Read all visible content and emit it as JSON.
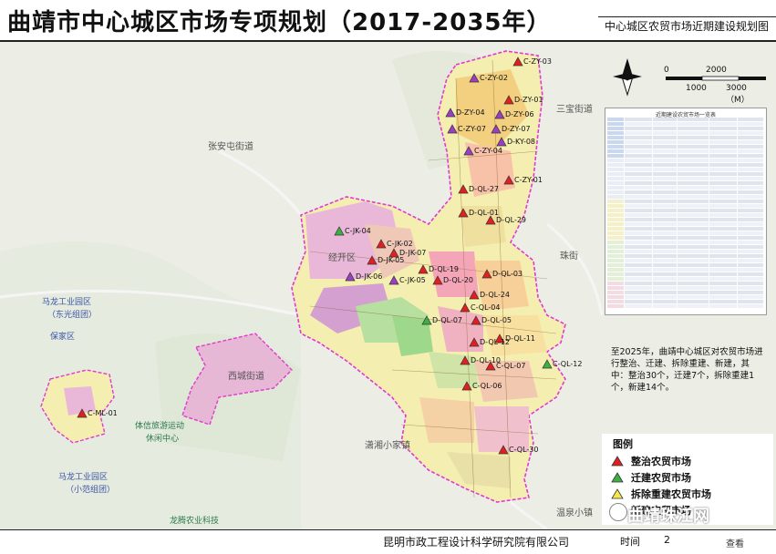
{
  "header": {
    "main_title": "曲靖市中心城区市场专项规划（2017-2035年）",
    "sub_title": "中心城区农贸市场近期建设规划图"
  },
  "scale": {
    "zero": "0",
    "mid_top": "2000",
    "mid_bottom": "1000",
    "end": "3000（M）"
  },
  "table": {
    "title": "近期建设农贸市场一览表"
  },
  "note": "至2025年，曲靖中心城区对农贸市场进行整治、迁建、拆除重建、新建，其中：整治30个，迁建7个，拆除重建1个，新建14个。",
  "legend": {
    "title": "图例",
    "items": [
      {
        "label": "整治农贸市场",
        "color": "#e02020"
      },
      {
        "label": "迁建农贸市场",
        "color": "#3cb043"
      },
      {
        "label": "拆除重建农贸市场",
        "color": "#f6e84a"
      },
      {
        "label": "新建农贸市场",
        "color": "#9a3fc0"
      }
    ]
  },
  "place_labels": [
    "张安屯街道",
    "经开区",
    "马龙工业园区",
    "（东光组团）",
    "保家区",
    "马龙工业园区",
    "（小范组团）",
    "体信旅游运动",
    "休闲中心",
    "龙腾农业科技",
    "潇湘小家镇",
    "三宝街道",
    "珠街",
    "西城街道",
    "温泉小镇"
  ],
  "markers": [
    {
      "label": "C-ZY-02",
      "type": "new"
    },
    {
      "label": "C-ZY-03",
      "type": "renovate"
    },
    {
      "label": "D-ZY-01",
      "type": "renovate"
    },
    {
      "label": "D-ZY-04",
      "type": "new"
    },
    {
      "label": "D-ZY-06",
      "type": "new"
    },
    {
      "label": "C-ZY-07",
      "type": "new"
    },
    {
      "label": "D-ZY-07",
      "type": "new"
    },
    {
      "label": "C-ZY-04",
      "type": "new"
    },
    {
      "label": "D-KY-08",
      "type": "new"
    },
    {
      "label": "C-ZY-01",
      "type": "renovate"
    },
    {
      "label": "D-QL-27",
      "type": "renovate"
    },
    {
      "label": "D-QL-01",
      "type": "renovate"
    },
    {
      "label": "D-QL-29",
      "type": "renovate"
    },
    {
      "label": "C-JK-04",
      "type": "relocate"
    },
    {
      "label": "C-JK-02",
      "type": "renovate"
    },
    {
      "label": "D-JK-07",
      "type": "renovate"
    },
    {
      "label": "D-JK-05",
      "type": "renovate"
    },
    {
      "label": "D-JK-06",
      "type": "new"
    },
    {
      "label": "C-JK-05",
      "type": "new"
    },
    {
      "label": "D-QL-19",
      "type": "renovate"
    },
    {
      "label": "D-QL-20",
      "type": "renovate"
    },
    {
      "label": "D-QL-03",
      "type": "renovate"
    },
    {
      "label": "D-QL-24",
      "type": "renovate"
    },
    {
      "label": "C-QL-04",
      "type": "renovate"
    },
    {
      "label": "D-QL-05",
      "type": "renovate"
    },
    {
      "label": "D-QL-07",
      "type": "relocate"
    },
    {
      "label": "D-QL-11",
      "type": "renovate"
    },
    {
      "label": "D-QL-12",
      "type": "renovate"
    },
    {
      "label": "D-QL-10",
      "type": "renovate"
    },
    {
      "label": "C-QL-07",
      "type": "renovate"
    },
    {
      "label": "C-QL-06",
      "type": "renovate"
    },
    {
      "label": "C-QL-12",
      "type": "relocate"
    },
    {
      "label": "C-QL-30",
      "type": "renovate"
    },
    {
      "label": "C-ML-01",
      "type": "renovate"
    }
  ],
  "footer": {
    "company": "昆明市政工程设计科学研究院有限公司",
    "time_label": "时间",
    "year": "2",
    "watermark": "曲靖珠江网",
    "view": "查看"
  }
}
